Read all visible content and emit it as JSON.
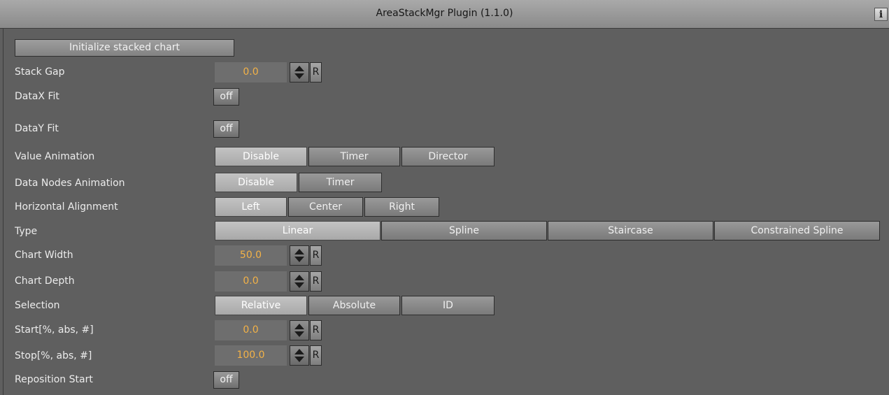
{
  "window": {
    "title": "AreaStackMgr Plugin (1.1.0)",
    "info_label": "i"
  },
  "init_button": "Initialize stacked chart",
  "fields": {
    "stack_gap": {
      "label": "Stack Gap",
      "value": "0.0"
    },
    "chart_width": {
      "label": "Chart Width",
      "value": "50.0"
    },
    "chart_depth": {
      "label": "Chart Depth",
      "value": "0.0"
    },
    "start": {
      "label": "Start[%, abs, #]",
      "value": "0.0"
    },
    "stop": {
      "label": "Stop[%, abs, #]",
      "value": "100.0"
    },
    "reset_label": "R"
  },
  "toggles": {
    "datax_fit": {
      "label": "DataX Fit",
      "value": "off"
    },
    "datay_fit": {
      "label": "DataY Fit",
      "value": "off"
    },
    "reposition_start": {
      "label": "Reposition Start",
      "value": "off"
    }
  },
  "value_animation": {
    "label": "Value Animation",
    "options": [
      "Disable",
      "Timer",
      "Director"
    ],
    "selected": "Disable"
  },
  "data_nodes_animation": {
    "label": "Data Nodes Animation",
    "options": [
      "Disable",
      "Timer"
    ],
    "selected": "Disable"
  },
  "horizontal_alignment": {
    "label": "Horizontal Alignment",
    "options": [
      "Left",
      "Center",
      "Right"
    ],
    "selected": "Left"
  },
  "type": {
    "label": "Type",
    "options": [
      "Linear",
      "Spline",
      "Staircase",
      "Constrained Spline"
    ],
    "selected": "Linear"
  },
  "selection": {
    "label": "Selection",
    "options": [
      "Relative",
      "Absolute",
      "ID"
    ],
    "selected": "Relative"
  },
  "colors": {
    "background": "#5f5f5f",
    "value_text": "#f3b247",
    "titlebar": "#9a9a9a"
  }
}
